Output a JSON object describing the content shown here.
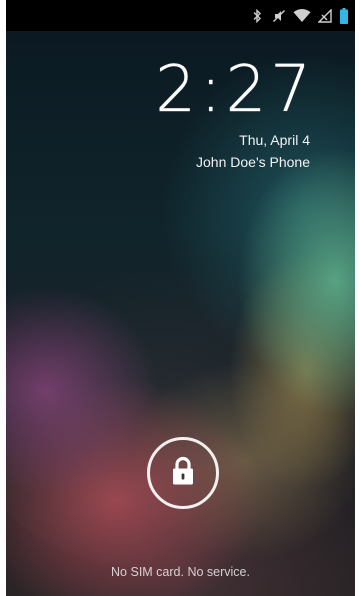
{
  "status_bar": {
    "icons": [
      "bluetooth-icon",
      "sound-off-icon",
      "wifi-icon",
      "no-signal-icon",
      "battery-icon"
    ]
  },
  "lockscreen": {
    "time": "2:27",
    "date": "Thu, April 4",
    "owner_info": "John Doe's Phone",
    "unlock_icon": "padlock-icon",
    "carrier_status": "No SIM card. No service."
  },
  "colors": {
    "accent_battery": "#33b5e5",
    "text": "#ffffff"
  }
}
